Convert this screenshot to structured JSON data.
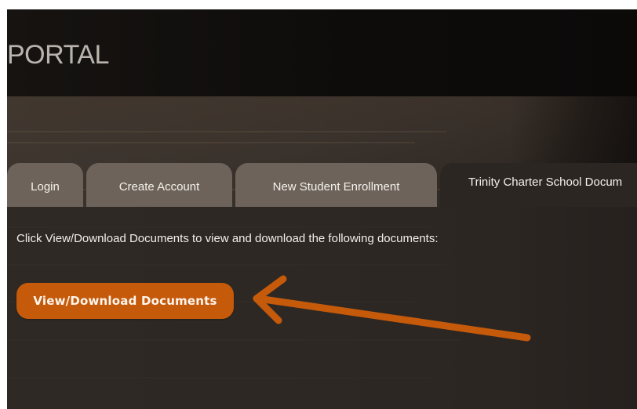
{
  "header": {
    "title": "PORTAL"
  },
  "tabs": [
    {
      "label": "Login",
      "active": false
    },
    {
      "label": "Create Account",
      "active": false
    },
    {
      "label": "New Student Enrollment",
      "active": false
    },
    {
      "label": "Trinity Charter School Docum",
      "active": true
    }
  ],
  "panel": {
    "instructions": "Click View/Download Documents to view and download the following documents:",
    "button_label": "View/Download Documents"
  },
  "annotation": {
    "icon": "arrow-left-annotation-icon",
    "color": "#c55a0b"
  },
  "colors": {
    "accent": "#c55a0b",
    "header_bg": "#0e0c0b",
    "tab_inactive": "#6d635a",
    "tab_active": "#2b2622",
    "text_light": "#f2efea"
  }
}
